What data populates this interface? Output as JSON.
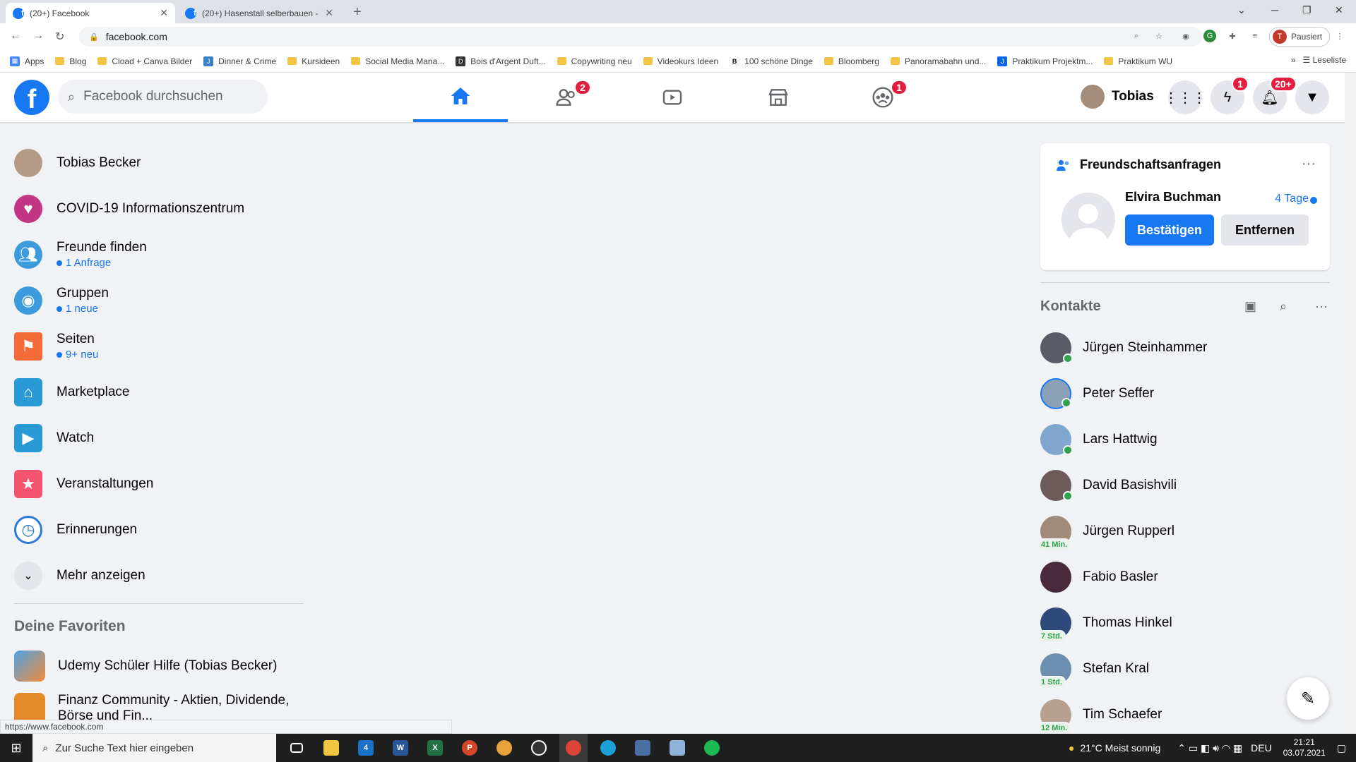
{
  "browser": {
    "tabs": [
      {
        "title": "(20+) Facebook",
        "active": true
      },
      {
        "title": "(20+) Hasenstall selberbauen - T",
        "active": false
      }
    ],
    "url": "facebook.com",
    "profile_status": "Pausiert",
    "profile_initial": "T",
    "bookmarks": [
      "Apps",
      "Blog",
      "Cload + Canva Bilder",
      "Dinner & Crime",
      "Kursideen",
      "Social Media Mana...",
      "Bois d'Argent Duft...",
      "Copywriting neu",
      "Videokurs Ideen",
      "100 schöne Dinge",
      "Bloomberg",
      "Panoramabahn und...",
      "Praktikum Projektm...",
      "Praktikum WU"
    ],
    "reading_list": "Leseliste",
    "status_url": "https://www.facebook.com"
  },
  "header": {
    "search_placeholder": "Facebook durchsuchen",
    "profile_name": "Tobias",
    "friends_badge": "2",
    "groups_badge": "1",
    "messenger_badge": "1",
    "notifications_badge": "20+",
    "brand_color": "#1877f2"
  },
  "leftnav": {
    "items": [
      {
        "label": "Tobias Becker",
        "sub": "",
        "icon": "profile-avatar"
      },
      {
        "label": "COVID-19 Informationszentrum",
        "sub": "",
        "icon": "heart-icon"
      },
      {
        "label": "Freunde finden",
        "sub": "1 Anfrage",
        "icon": "friends-icon"
      },
      {
        "label": "Gruppen",
        "sub": "1 neue",
        "icon": "groups-icon"
      },
      {
        "label": "Seiten",
        "sub": "9+ neu",
        "icon": "flag-icon"
      },
      {
        "label": "Marketplace",
        "sub": "",
        "icon": "shop-icon"
      },
      {
        "label": "Watch",
        "sub": "",
        "icon": "play-icon"
      },
      {
        "label": "Veranstaltungen",
        "sub": "",
        "icon": "calendar-icon"
      },
      {
        "label": "Erinnerungen",
        "sub": "",
        "icon": "clock-icon"
      },
      {
        "label": "Mehr anzeigen",
        "sub": "",
        "icon": "chevron-down-icon"
      }
    ],
    "favorites_title": "Deine Favoriten",
    "favorites": [
      "Udemy Schüler Hilfe (Tobias Becker)",
      "Finanz Community - Aktien, Dividende, Börse und Fin..."
    ]
  },
  "friend_request": {
    "title": "Freundschaftsanfragen",
    "name": "Elvira Buchman",
    "when": "4 Tage",
    "confirm": "Bestätigen",
    "remove": "Entfernen"
  },
  "contacts": {
    "title": "Kontakte",
    "items": [
      {
        "name": "Jürgen Steinhammer",
        "status": "online",
        "away": ""
      },
      {
        "name": "Peter Seffer",
        "status": "online",
        "away": ""
      },
      {
        "name": "Lars Hattwig",
        "status": "online",
        "away": ""
      },
      {
        "name": "David Basishvili",
        "status": "online",
        "away": ""
      },
      {
        "name": "Jürgen Rupperl",
        "status": "away",
        "away": "41 Min."
      },
      {
        "name": "Fabio Basler",
        "status": "none",
        "away": ""
      },
      {
        "name": "Thomas Hinkel",
        "status": "away",
        "away": "7 Std."
      },
      {
        "name": "Stefan Kral",
        "status": "away",
        "away": "1 Std."
      },
      {
        "name": "Tim Schaefer",
        "status": "away",
        "away": "12 Min."
      }
    ]
  },
  "taskbar": {
    "search_placeholder": "Zur Suche Text hier eingeben",
    "mail_badge": "4",
    "weather": "21°C  Meist sonnig",
    "lang": "DEU",
    "time": "21:21",
    "date": "03.07.2021"
  }
}
